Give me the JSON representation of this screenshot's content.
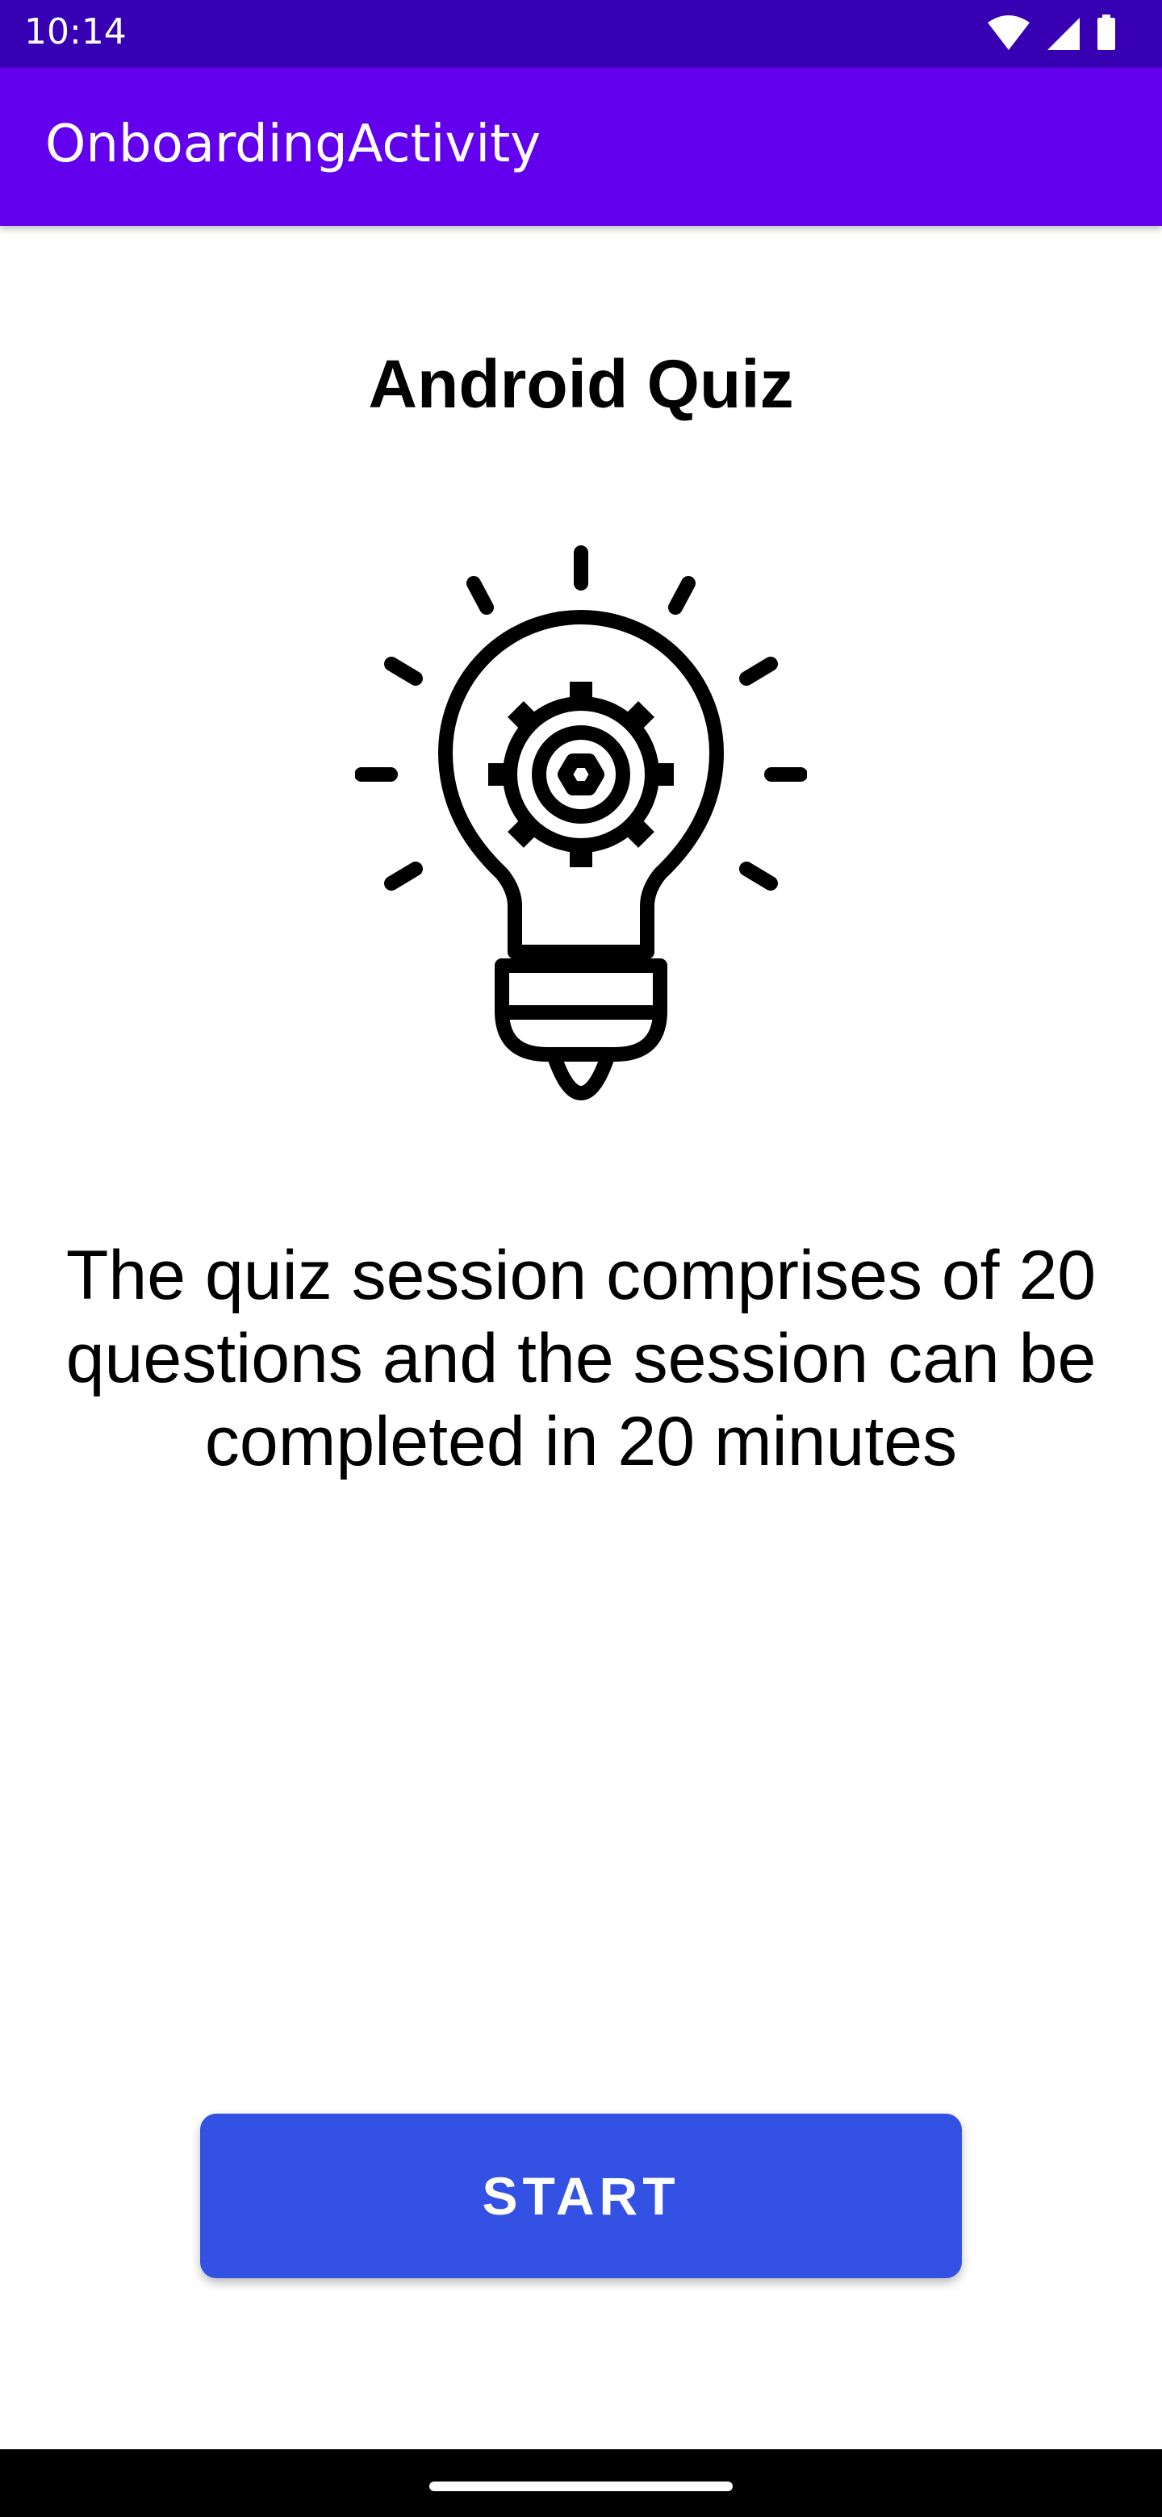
{
  "status_bar": {
    "time": "10:14",
    "icons": [
      "wifi-icon",
      "cellular-icon",
      "battery-icon"
    ],
    "background_color": "#3700b3"
  },
  "app_bar": {
    "title": "OnboardingActivity",
    "background_color": "#6200ee"
  },
  "main": {
    "title": "Android Quiz",
    "illustration_icon": "lightbulb-gear-icon",
    "description": "The quiz session comprises of 20 questions and the session can be completed in 20 minutes",
    "start_button_label": "START",
    "start_button_color": "#3352e4"
  },
  "nav_bar": {
    "handle": "gesture-handle"
  }
}
